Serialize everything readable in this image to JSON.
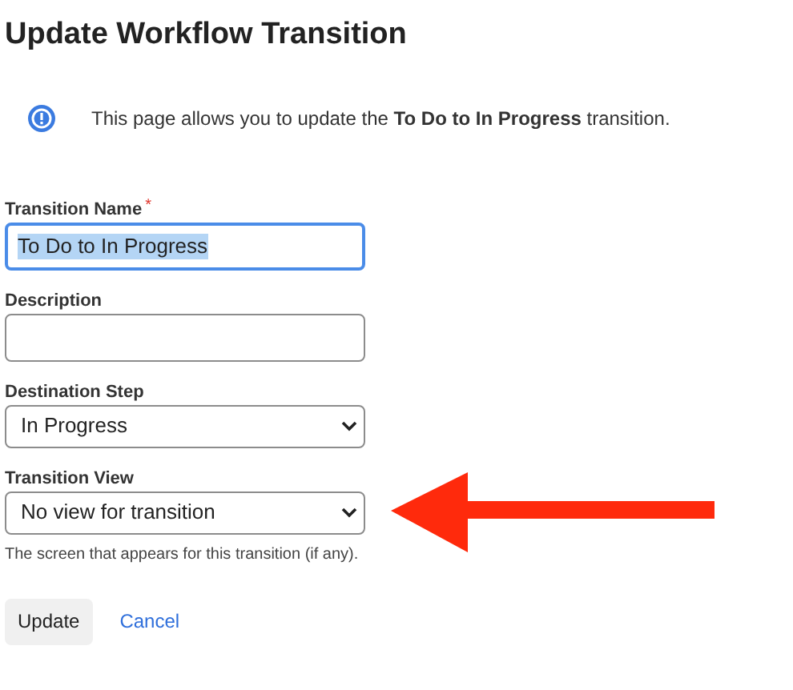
{
  "title": "Update Workflow Transition",
  "info": "This page allows you to update the **To Do to In Progress** transition.",
  "fields": [
    {
      "kind": "text",
      "label": "Transition Name",
      "required_mark": "*",
      "focused": true,
      "value": "To Do to In Progress"
    },
    {
      "kind": "text",
      "label": "Description",
      "focused": false
    },
    {
      "kind": "select",
      "label": "Destination Step",
      "focused": false,
      "value": "In Progress"
    },
    {
      "kind": "select",
      "label": "Transition View",
      "focused": false,
      "value": "No view for transition",
      "help": "The screen that appears for this transition (if any)."
    }
  ],
  "buttons": [
    {
      "kind": "primary",
      "label": "Update"
    },
    {
      "kind": "link",
      "label": "Cancel"
    }
  ]
}
